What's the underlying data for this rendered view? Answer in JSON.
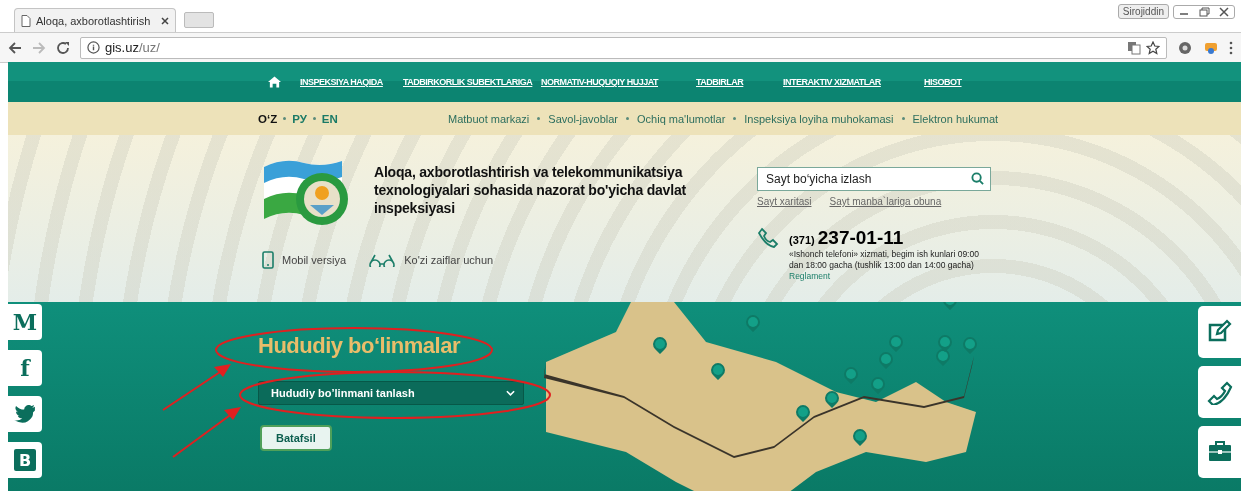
{
  "browser": {
    "tab_title": "Aloqa, axborotlashtirish",
    "profile": "Sirojiddin",
    "url_host": "gis.uz",
    "url_path": "/uz/"
  },
  "nav": {
    "items": [
      "INSPEKSIYA HAQIDA",
      "TADBIRKORLIK SUBEKTLARIGA",
      "NORMATIV-HUQUQIY HUJJAT",
      "TADBIRLAR",
      "INTERAKTIV XIZMATLAR",
      "HISOBOT"
    ]
  },
  "languages": [
    {
      "label": "O‘Z",
      "selected": true
    },
    {
      "label": "РУ",
      "selected": false
    },
    {
      "label": "EN",
      "selected": false
    }
  ],
  "top_links": [
    "Matbuot markazi",
    "Savol-javoblar",
    "Ochiq ma'lumotlar",
    "Inspeksiya loyiha muhokamasi",
    "Elektron hukumat"
  ],
  "header": {
    "title": "Aloqa, axborotlashtirish va telekommunikatsiya texnologiyalari sohasida nazorat bo'yicha davlat inspeksiyasi",
    "mobile": "Mobil versiya",
    "low_vision": "Ko'zi zaiflar uchun",
    "search": {
      "placeholder": "Sayt bo‘yicha izlash"
    },
    "links": [
      "Sayt xaritasi",
      "Sayt manba`lariga obuna"
    ],
    "phone": {
      "code": "(371)",
      "number": "237-01-11",
      "note": "«Ishonch telefoni» xizmati, begim ish kunlari 09:00 dan 18:00 gacha (tushlik 13:00 dan 14:00 gacha)",
      "link": "Reglament"
    }
  },
  "social": [
    {
      "kind": "letter",
      "glyph": "M"
    },
    {
      "kind": "letter",
      "glyph": "f"
    },
    {
      "kind": "twitter"
    },
    {
      "kind": "boxed",
      "glyph": "B"
    }
  ],
  "hero": {
    "title": "Hududiy bo‘linmalar",
    "select": "Hududiy bo’linmani tanlash",
    "button": "Batafsil"
  },
  "right_tools": [
    {
      "kind": "edit"
    },
    {
      "kind": "phone"
    },
    {
      "kind": "briefcase"
    }
  ]
}
